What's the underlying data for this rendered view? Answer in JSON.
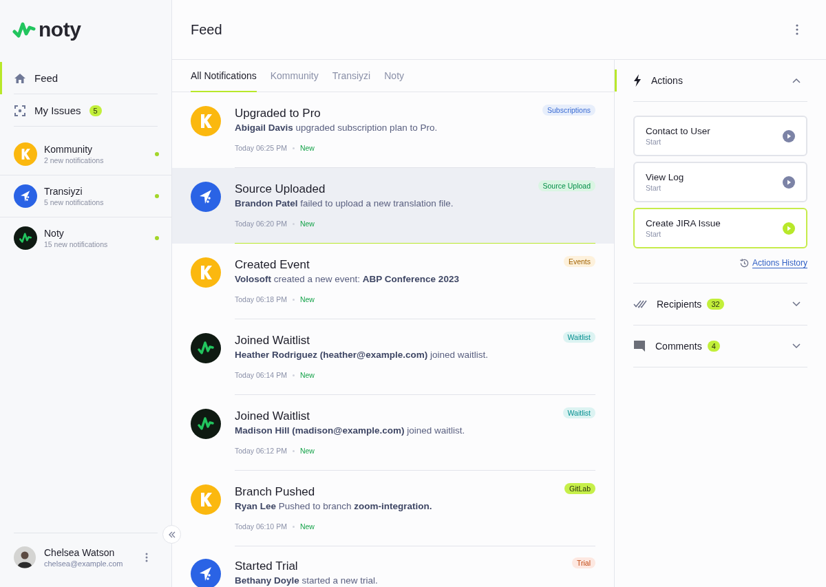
{
  "logo": {
    "name": "noty"
  },
  "sidebar": {
    "nav": [
      {
        "label": "Feed",
        "selected": true
      },
      {
        "label": "My Issues",
        "selected": false,
        "badge": "5"
      }
    ],
    "projects": [
      {
        "name": "Kommunity",
        "subtitle": "2 new notifications",
        "kind": "kommunity",
        "unread": true
      },
      {
        "name": "Transiyzi",
        "subtitle": "5 new notifications",
        "kind": "transiyzi",
        "unread": true
      },
      {
        "name": "Noty",
        "subtitle": "15 new notifications",
        "kind": "noty",
        "unread": true
      }
    ],
    "user": {
      "name": "Chelsea Watson",
      "email": "chelsea@example.com"
    }
  },
  "header": {
    "title": "Feed"
  },
  "tabs": [
    {
      "label": "All Notifications",
      "selected": true
    },
    {
      "label": "Kommunity",
      "selected": false
    },
    {
      "label": "Transiyzi",
      "selected": false
    },
    {
      "label": "Noty",
      "selected": false
    }
  ],
  "feed": [
    {
      "kind": "kommunity",
      "title": "Upgraded to Pro",
      "body": "**Abigail Davis** upgraded subscription plan to Pro.",
      "time": "Today 06:25 PM",
      "status": "New",
      "tag": "Subscriptions",
      "color": "#e7eefb",
      "selected": false
    },
    {
      "kind": "transiyzi",
      "title": "Source Uploaded",
      "body": "**Brandon Patel** failed to upload a new translation file.",
      "time": "Today 06:20 PM",
      "status": "New",
      "tag": "Source Upload",
      "color": "#daf5e3",
      "selected": true
    },
    {
      "kind": "kommunity",
      "title": "Created Event",
      "body": "**Volosoft** created a new event: **ABP Conference 2023**",
      "time": "Today 06:18 PM",
      "status": "New",
      "tag": "Events",
      "color": "#fdf1dc",
      "selected": false
    },
    {
      "kind": "noty",
      "title": "Joined Waitlist",
      "body": "**Heather Rodriguez (heather@example.com)** joined waitlist.",
      "time": "Today 06:14 PM",
      "status": "New",
      "tag": "Waitlist",
      "color": "#dcf3f2",
      "selected": false
    },
    {
      "kind": "noty",
      "title": "Joined Waitlist",
      "body": "**Madison Hill  (madison@example.com)** joined waitlist.",
      "time": "Today 06:12 PM",
      "status": "New",
      "tag": "Waitlist",
      "color": "#dcf3f2",
      "selected": false
    },
    {
      "kind": "kommunity",
      "title": "Branch Pushed",
      "body": "**Ryan Lee** Pushed to branch **zoom-integration.**",
      "time": "Today 06:10 PM",
      "status": "New",
      "tag": "GitLab",
      "color": "#c6ef4a",
      "selected": false
    },
    {
      "kind": "transiyzi",
      "title": "Started Trial",
      "body": "**Bethany Doyle** started a new trial.",
      "tag": "Trial",
      "color": "#fde8e1",
      "selected": false
    }
  ],
  "panel": {
    "actions": {
      "title": "Actions",
      "expanded": true,
      "items": [
        {
          "title": "Contact to User",
          "subtitle": "Start",
          "selected": false
        },
        {
          "title": "View Log",
          "subtitle": "Start",
          "selected": false
        },
        {
          "title": "Create JIRA Issue",
          "subtitle": "Start",
          "selected": true
        }
      ],
      "history_link": "Actions History"
    },
    "sections": [
      {
        "title": "Recipients",
        "badge": "32",
        "expanded": false
      },
      {
        "title": "Comments",
        "badge": "4",
        "expanded": false
      }
    ]
  }
}
